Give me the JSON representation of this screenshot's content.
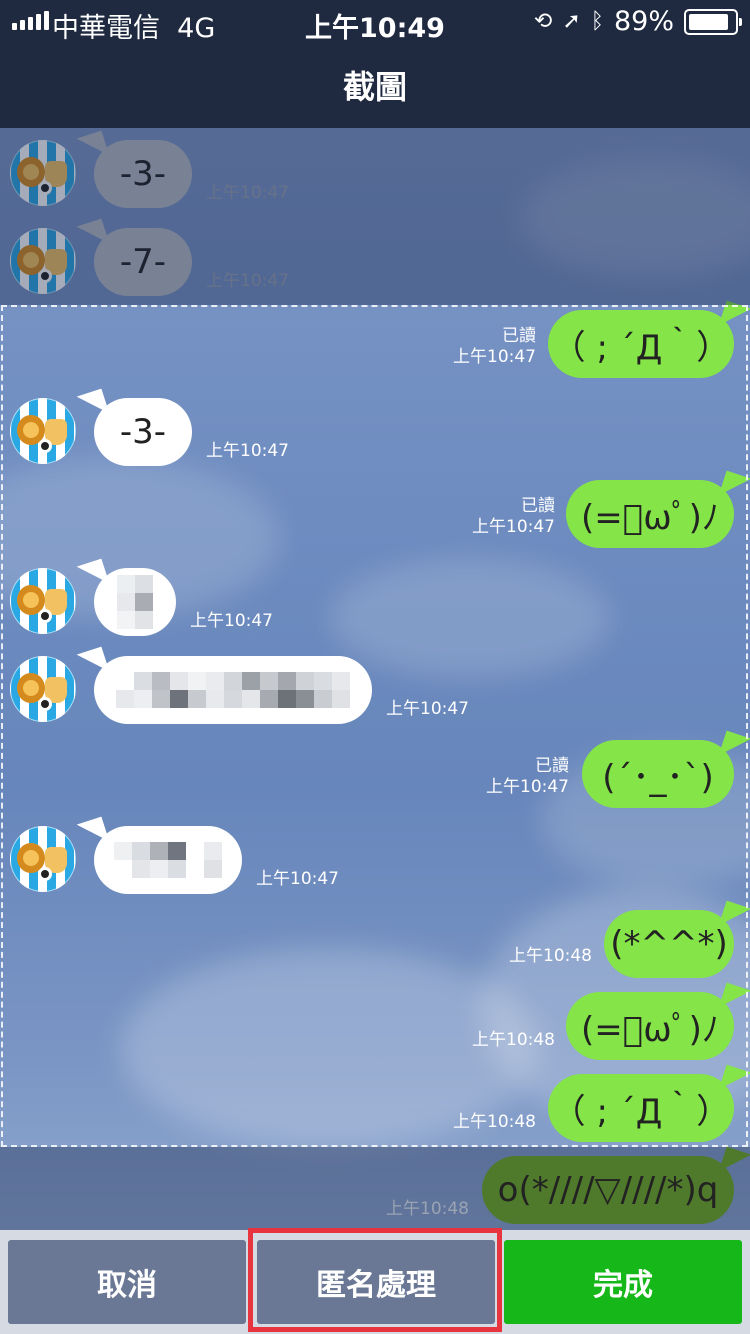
{
  "status_bar": {
    "carrier": "中華電信",
    "network": "4G",
    "time": "上午10:49",
    "battery": "89%",
    "battery_level": 0.89
  },
  "nav": {
    "title": "截圖"
  },
  "messages": {
    "m1": {
      "text": "-3-",
      "time": "上午10:47"
    },
    "m2": {
      "text": "-7-",
      "time": "上午10:47"
    },
    "m3": {
      "text": "（ ; ´Д｀）",
      "time": "上午10:47",
      "read": "已讀"
    },
    "m4": {
      "text": "-3-",
      "time": "上午10:47"
    },
    "m5": {
      "text": "(=ﾟωﾟ)ﾉ",
      "time": "上午10:47",
      "read": "已讀"
    },
    "m6": {
      "time": "上午10:47"
    },
    "m7": {
      "time": "上午10:47"
    },
    "m8": {
      "text": "(´･_･`)",
      "time": "上午10:47",
      "read": "已讀"
    },
    "m9": {
      "time": "上午10:47"
    },
    "m10": {
      "text": "(*^^*)",
      "time": "上午10:48"
    },
    "m11": {
      "text": "(=ﾟωﾟ)ﾉ",
      "time": "上午10:48"
    },
    "m12": {
      "text": "（ ; ´Д｀）",
      "time": "上午10:48"
    },
    "m13": {
      "text": "o(*////▽////*)q",
      "time": "上午10:48"
    }
  },
  "toolbar": {
    "cancel_label": "取消",
    "anonymize_label": "匿名處理",
    "done_label": "完成"
  },
  "colors": {
    "header_bg": "#1f2a41",
    "bubble_out": "#84e448",
    "done_button": "#15b719",
    "secondary_button": "#6b7895",
    "highlight": "#e8343f"
  }
}
